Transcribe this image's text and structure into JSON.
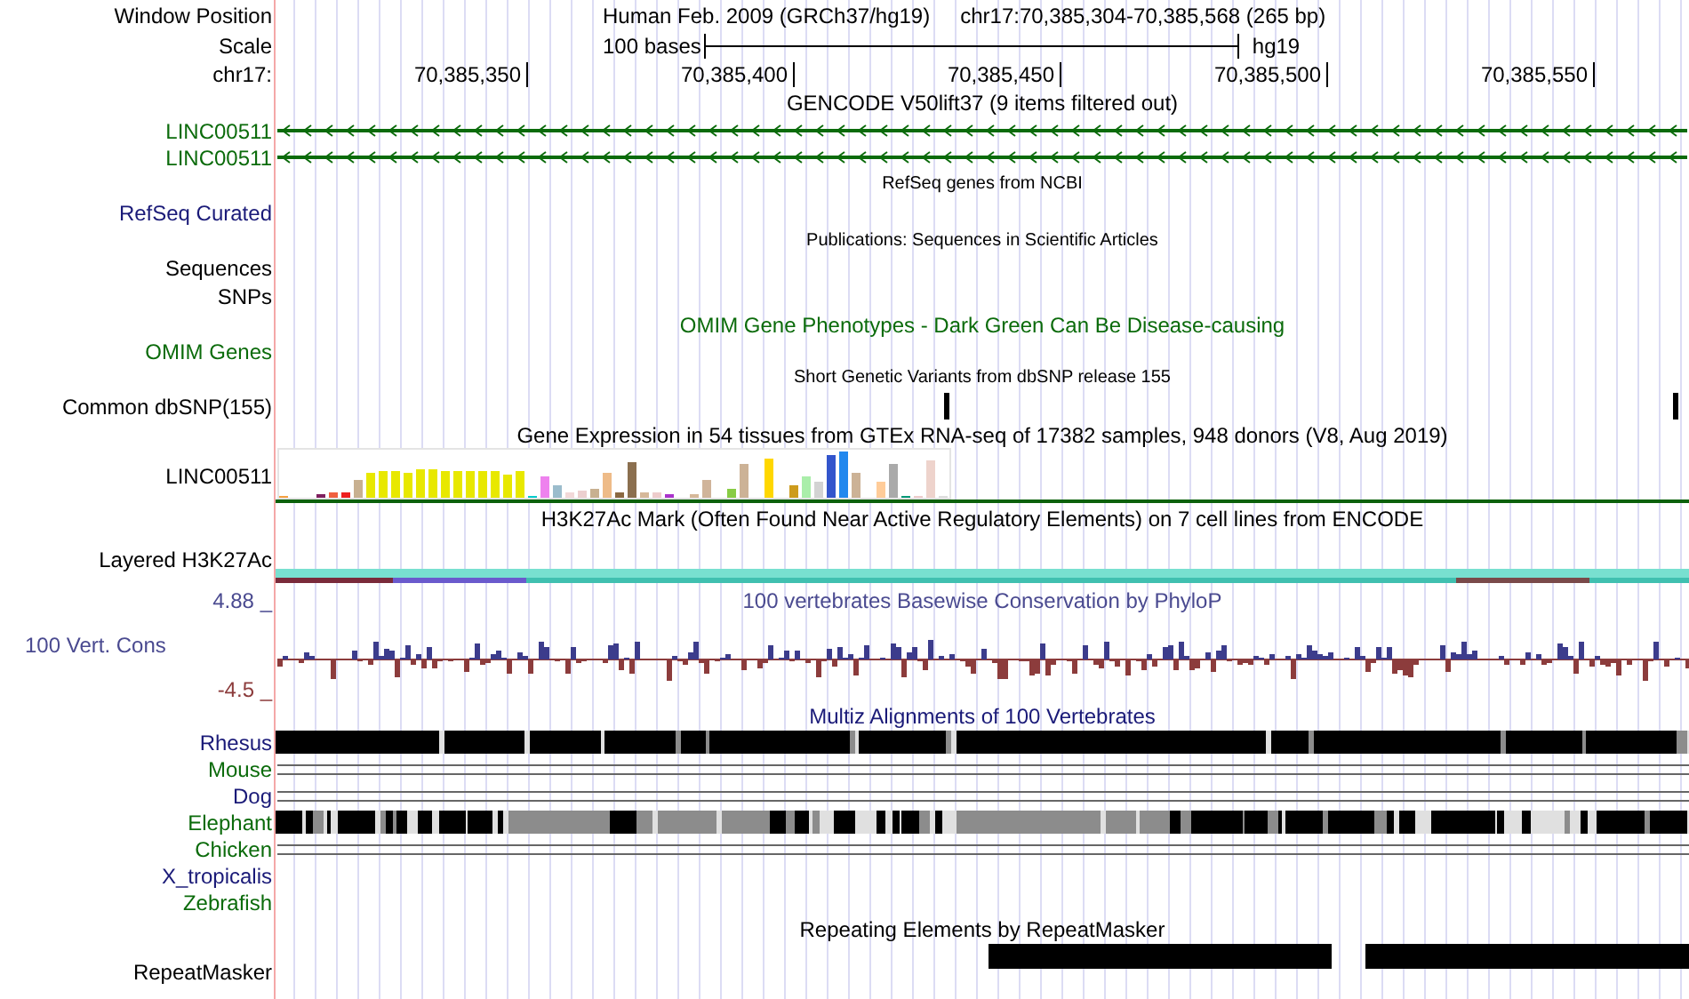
{
  "position_row": {
    "label": "Window Position",
    "assembly": "Human Feb. 2009 (GRCh37/hg19)",
    "range": "chr17:70,385,304-70,385,568 (265 bp)"
  },
  "scale_row": {
    "label": "Scale",
    "length": "100 bases",
    "assembly": "hg19"
  },
  "ruler": {
    "label": "chr17:",
    "ticks": [
      "70,385,350",
      "70,385,400",
      "70,385,450",
      "70,385,500",
      "70,385,550"
    ]
  },
  "gencode": {
    "title": "GENCODE V50lift37 (9 items filtered out)",
    "genes": [
      {
        "name": "LINC00511"
      },
      {
        "name": "LINC00511"
      }
    ]
  },
  "refseq": {
    "title": "RefSeq genes from NCBI",
    "label": "RefSeq Curated"
  },
  "publications": {
    "title": "Publications: Sequences in Scientific Articles",
    "labels": [
      "Sequences",
      "SNPs"
    ]
  },
  "omim": {
    "title": "OMIM Gene Phenotypes - Dark Green Can Be Disease-causing",
    "label": "OMIM Genes"
  },
  "dbsnp": {
    "title": "Short Genetic Variants from dbSNP release 155",
    "label": "Common dbSNP(155)"
  },
  "gtex": {
    "title": "Gene Expression in 54 tissues from GTEx RNA-seq of 17382 samples, 948 donors (V8, Aug 2019)",
    "label": "LINC00511"
  },
  "h3k27ac": {
    "title": "H3K27Ac Mark (Often Found Near Active Regulatory Elements) on 7 cell lines from ENCODE",
    "label": "Layered H3K27Ac"
  },
  "conservation": {
    "title": "100 vertebrates Basewise Conservation by PhyloP",
    "label": "100 Vert. Cons",
    "max": "4.88 _",
    "min": "-4.5 _"
  },
  "multiz": {
    "title": "Multiz Alignments of 100 Vertebrates",
    "species": [
      {
        "name": "Rhesus",
        "kind": "blocks",
        "color": "#1a1a78"
      },
      {
        "name": "Mouse",
        "kind": "lines",
        "color": "#0b6b0b"
      },
      {
        "name": "Dog",
        "kind": "lines",
        "color": "#1a1a78"
      },
      {
        "name": "Elephant",
        "kind": "blocks",
        "color": "#0b6b0b"
      },
      {
        "name": "Chicken",
        "kind": "lines",
        "color": "#0b6b0b"
      },
      {
        "name": "X_tropicalis",
        "kind": "empty",
        "color": "#1a1a78"
      },
      {
        "name": "Zebrafish",
        "kind": "empty",
        "color": "#0b6b0b"
      }
    ]
  },
  "repeatmasker": {
    "title": "Repeating Elements by RepeatMasker",
    "label": "RepeatMasker"
  }
}
